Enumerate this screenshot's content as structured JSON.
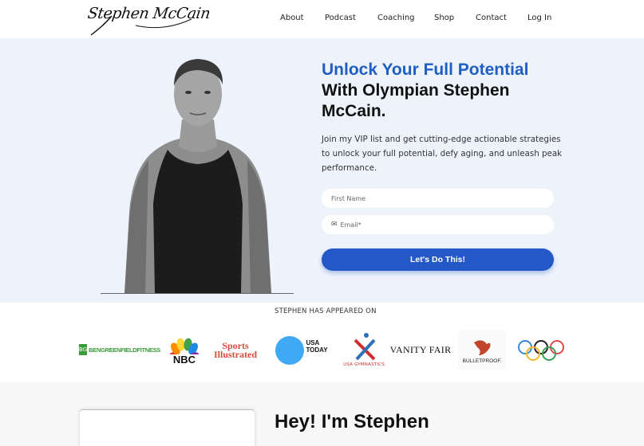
{
  "header": {
    "logo_text": "Stephen McCain",
    "nav": [
      "About",
      "Podcast",
      "Coaching",
      "Shop",
      "Contact",
      "Log In"
    ]
  },
  "hero": {
    "headline_blue": "Unlock Your Full Potential",
    "headline_rest": "With Olympian Stephen McCain.",
    "subtext": "Join my VIP list and get cutting-edge actionable strategies to unlock your full potential, defy aging, and unleash peak performance.",
    "first_name_placeholder": "First Name",
    "email_placeholder": "Email*",
    "cta_label": "Let's Do This!"
  },
  "appeared": {
    "title": "STEPHEN HAS APPEARED ON",
    "logos": {
      "bengreenfield": "BENGREENFIELDFITNESS",
      "nbc": "NBC",
      "si_line1": "Sports",
      "si_line2": "Illustrated",
      "usatoday_line1": "USA",
      "usatoday_line2": "TODAY",
      "usagym": "USA GYMNASTICS.",
      "vanityfair": "VANITY FAIR",
      "bulletproof": "BULLETPROOF."
    }
  },
  "about": {
    "title": "Hey! I'm Stephen"
  },
  "colors": {
    "accent": "#1f5fc4",
    "cta": "#2558c7",
    "hero_bg": "#eef3fb"
  }
}
